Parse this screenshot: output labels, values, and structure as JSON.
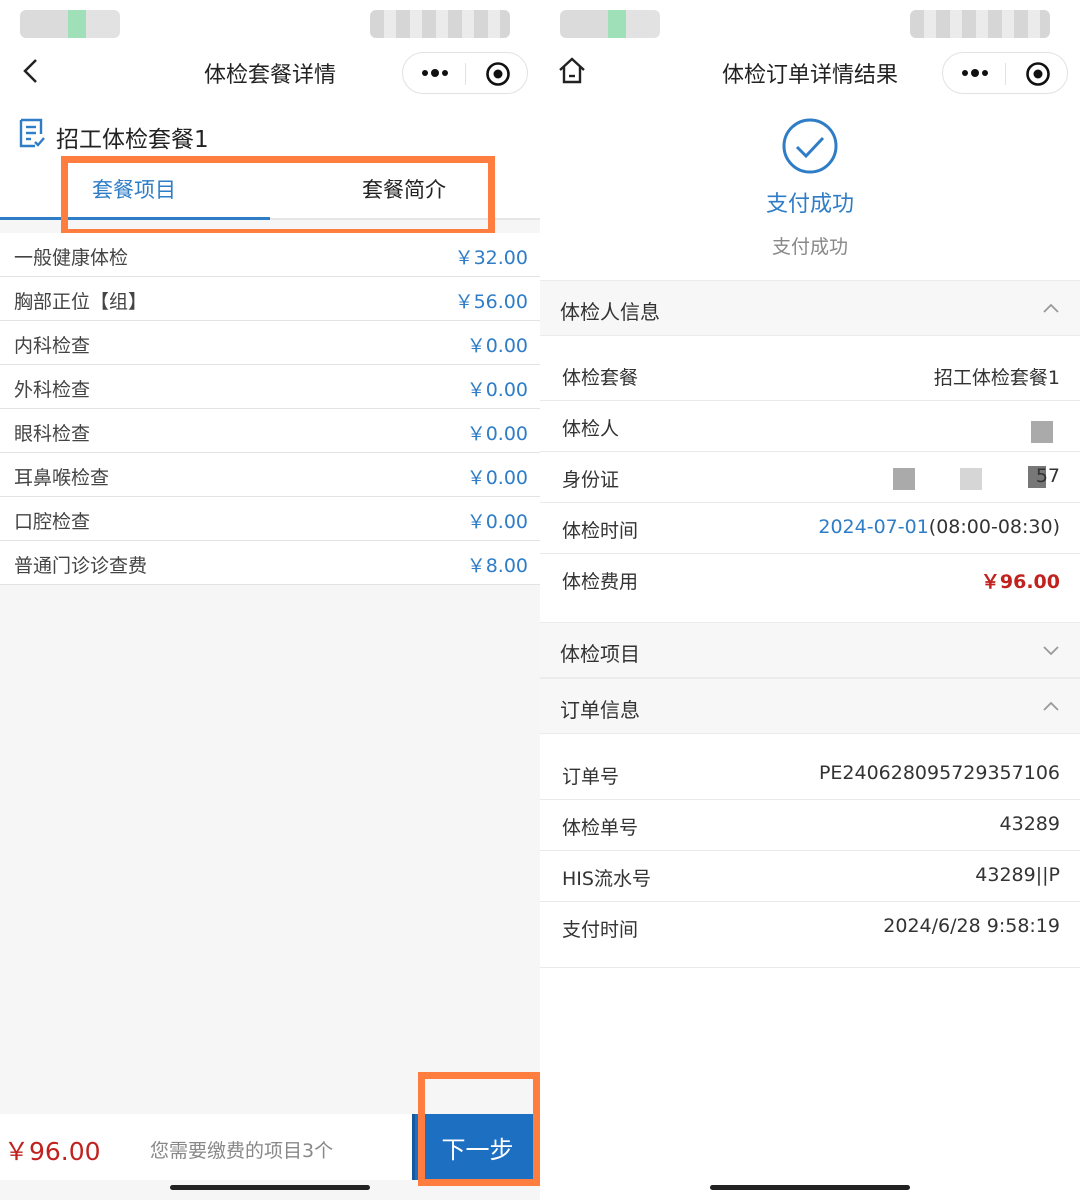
{
  "left": {
    "nav_title": "体检套餐详情",
    "package_name": "招工体检套餐1",
    "tabs": [
      {
        "label": "套餐项目",
        "active": true
      },
      {
        "label": "套餐简介",
        "active": false
      }
    ],
    "items": [
      {
        "name": "一般健康体检",
        "price": "￥32.00"
      },
      {
        "name": "胸部正位【组】",
        "price": "￥56.00"
      },
      {
        "name": "内科检查",
        "price": "￥0.00"
      },
      {
        "name": "外科检查",
        "price": "￥0.00"
      },
      {
        "name": "眼科检查",
        "price": "￥0.00"
      },
      {
        "name": "耳鼻喉检查",
        "price": "￥0.00"
      },
      {
        "name": "口腔检查",
        "price": "￥0.00"
      },
      {
        "name": "普通门诊诊查费",
        "price": "￥8.00"
      }
    ],
    "bottom": {
      "total": "￥96.00",
      "hint": "您需要缴费的项目3个",
      "next_label": "下一步"
    }
  },
  "right": {
    "nav_title": "体检订单详情结果",
    "success_title": "支付成功",
    "success_subtitle": "支付成功",
    "section_person": "体检人信息",
    "person_rows": {
      "package_label": "体检套餐",
      "package_value": "招工体检套餐1",
      "person_label": "体检人",
      "id_label": "身份证",
      "id_value_suffix": "57",
      "time_label": "体检时间",
      "time_date": "2024-07-01",
      "time_range": "(08:00-08:30)",
      "fee_label": "体检费用",
      "fee_value": "￥96.00"
    },
    "section_items": "体检项目",
    "section_order": "订单信息",
    "order_rows": [
      {
        "label": "订单号",
        "value": "PE240628095729357106"
      },
      {
        "label": "体检单号",
        "value": "43289"
      },
      {
        "label": "HIS流水号",
        "value": "43289||P"
      },
      {
        "label": "支付时间",
        "value": "2024/6/28 9:58:19"
      }
    ]
  },
  "colors": {
    "accent_blue": "#2f7dc7",
    "button_blue": "#1d6fc2",
    "price_red": "#c0221f",
    "highlight_orange": "#ff7d3f"
  }
}
